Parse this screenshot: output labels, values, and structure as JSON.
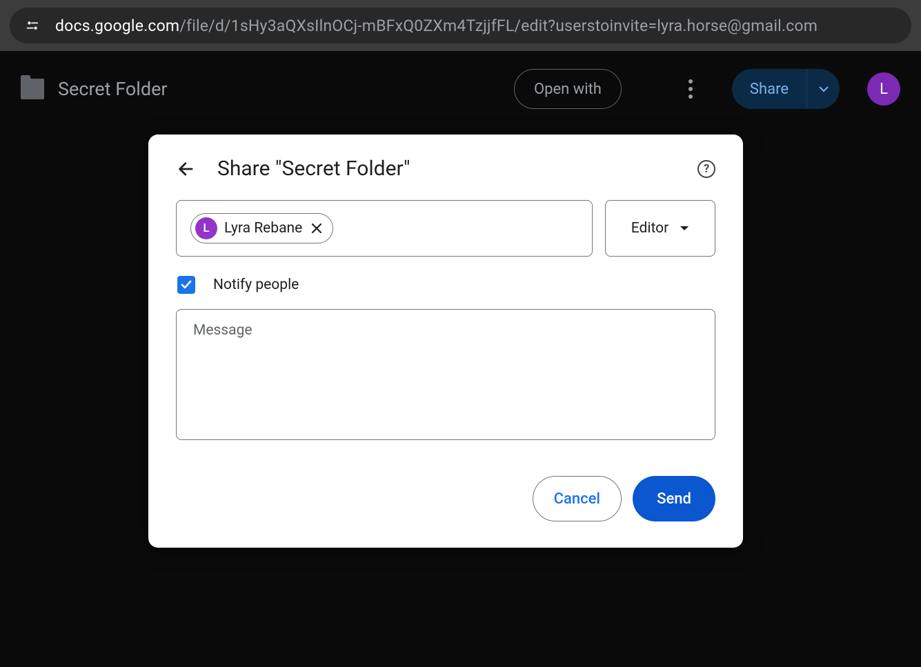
{
  "url": {
    "host": "docs.google.com",
    "path": "/file/d/1sHy3aQXsIlnOCj-mBFxQ0ZXm4TzjjfFL/edit?userstoinvite=lyra.horse@gmail.com"
  },
  "header": {
    "page_title": "Secret Folder",
    "open_with_label": "Open with",
    "share_label": "Share",
    "avatar_initial": "L",
    "avatar_bg": "#7b2ab5"
  },
  "dialog": {
    "title": "Share \"Secret Folder\"",
    "chip": {
      "initial": "L",
      "name": "Lyra Rebane",
      "avatar_bg": "#9334c9"
    },
    "role": "Editor",
    "notify_label": "Notify people",
    "notify_checked": true,
    "message_placeholder": "Message",
    "cancel_label": "Cancel",
    "send_label": "Send"
  }
}
